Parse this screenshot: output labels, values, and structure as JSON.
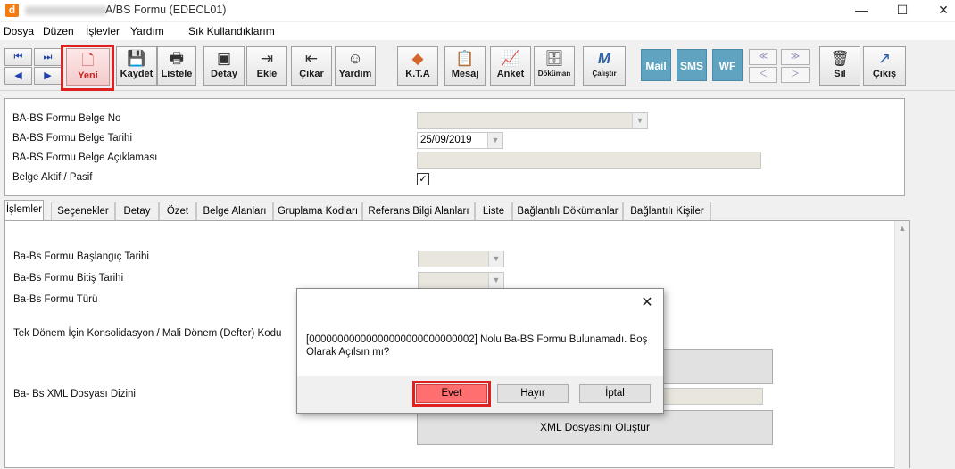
{
  "window": {
    "logo_letter": "d",
    "title": "A/BS Formu (EDECL01)",
    "minimize": "—",
    "maximize": "☐",
    "close": "✕"
  },
  "menu": [
    "Dosya",
    "Düzen",
    "İşlevler",
    "Yardım",
    "Sık Kullandıklarım"
  ],
  "toolbar": {
    "yeni": "Yeni",
    "kaydet": "Kaydet",
    "listele": "Listele",
    "detay": "Detay",
    "ekle": "Ekle",
    "cikar": "Çıkar",
    "yardim": "Yardım",
    "kta": "K.T.A",
    "mesaj": "Mesaj",
    "anket": "Anket",
    "dokuman": "Döküman",
    "calistir": "Çalıştır",
    "mail": "Mail",
    "sms": "SMS",
    "wf": "WF",
    "sil": "Sil",
    "cikis": "Çıkış"
  },
  "header": {
    "belge_no_label": "BA-BS Formu Belge No",
    "belge_no_value": "",
    "belge_tarihi_label": "BA-BS Formu Belge Tarihi",
    "belge_tarihi_value": "25/09/2019",
    "aciklama_label": "BA-BS Formu Belge Açıklaması",
    "aciklama_value": "",
    "aktif_label": "Belge Aktif / Pasif",
    "aktif_checked": true
  },
  "tabs": [
    "İşlemler",
    "Seçenekler",
    "Detay",
    "Özet",
    "Belge Alanları",
    "Gruplama Kodları",
    "Referans Bilgi Alanları",
    "Liste",
    "Bağlantılı Dökümanlar",
    "Bağlantılı Kişiler"
  ],
  "active_tab": "İşlemler",
  "content": {
    "baslangic_label": "Ba-Bs Formu Başlangıç Tarihi",
    "bitis_label": "Ba-Bs Formu Bitiş Tarihi",
    "turu_label": "Ba-Bs Formu Türü",
    "konsolidasyon_label": "Tek Dönem İçin Konsolidasyon / Mali Dönem (Defter) Kodu",
    "xml_dizin_label": "Ba- Bs XML Dosyası Dizini",
    "xml_olustur_button": "XML Dosyasını Oluştur"
  },
  "dialog": {
    "close": "✕",
    "message": "[00000000000000000000000000002] Nolu Ba-BS Formu Bulunamadı. Boş Olarak Açılsın mı?",
    "evet": "Evet",
    "hayir": "Hayır",
    "iptal": "İptal"
  },
  "highlight_color": "#e02020",
  "accent_colors": {
    "logo": "#f27b12",
    "blue_buttons": "#5fa3c0",
    "evet_button": "#ff6f6f"
  }
}
